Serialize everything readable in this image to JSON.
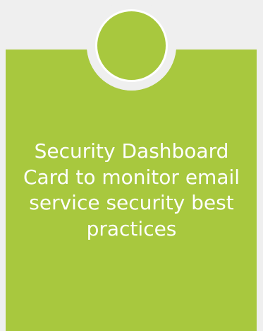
{
  "card": {
    "description": "Security Dashboard Card to monitor email service security best practices",
    "background_color": "#a8c83e",
    "text_color": "#ffffff",
    "badge_icon": "circle-badge-icon"
  },
  "page": {
    "background_color": "#efefef"
  }
}
